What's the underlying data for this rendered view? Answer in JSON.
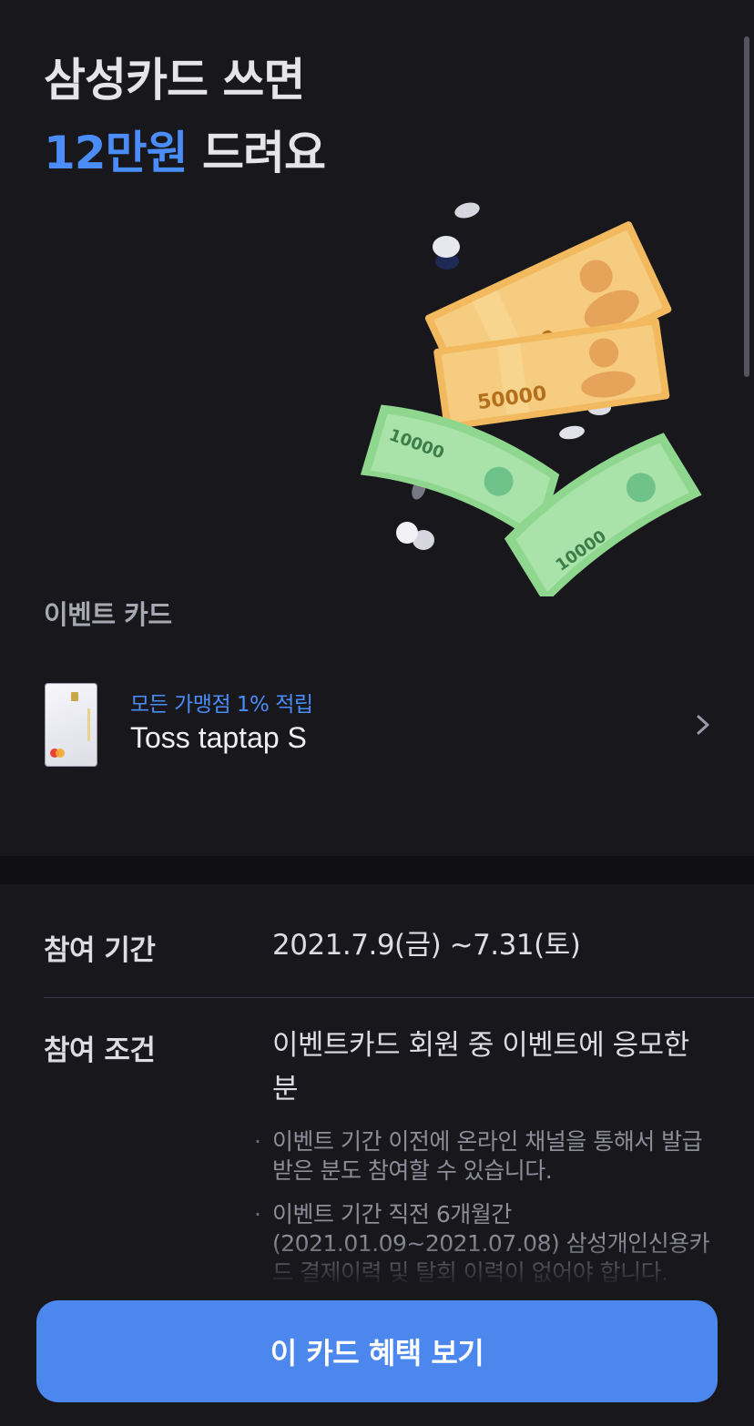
{
  "hero": {
    "line1": "삼성카드 쓰면",
    "accent": "12만원",
    "line2_rest": " 드려요"
  },
  "illustration": {
    "notes": [
      {
        "denomination": "50000",
        "color": "#f3c271"
      },
      {
        "denomination": "50000",
        "color": "#f3c271"
      },
      {
        "denomination": "10000",
        "color": "#9fdc9f"
      },
      {
        "denomination": "10000",
        "color": "#9fdc9f"
      }
    ],
    "icon": "money-notes-and-coins-icon"
  },
  "event_card_section": {
    "label": "이벤트 카드",
    "card": {
      "benefit": "모든 가맹점 1% 적립",
      "name": "Toss taptap S",
      "chevron_icon": "chevron-right-icon"
    }
  },
  "details": {
    "period": {
      "label": "참여 기간",
      "value": "2021.7.9(금) ~7.31(토)"
    },
    "condition": {
      "label": "참여 조건",
      "value": "이벤트카드 회원 중 이벤트에 응모한 분",
      "notes": [
        "이벤트 기간 이전에 온라인 채널을 통해서 발급받은 분도 참여할 수 있습니다.",
        "이벤트 기간 직전 6개월간(2021.01.09~2021.07.08) 삼성개인신용카드 결제이력 및 탈회 이력이 없어야 합니다."
      ]
    }
  },
  "cta": {
    "label": "이 카드 혜택 보기"
  },
  "colors": {
    "background": "#17171c",
    "accent": "#4b8df8",
    "button": "#4b87ed"
  }
}
